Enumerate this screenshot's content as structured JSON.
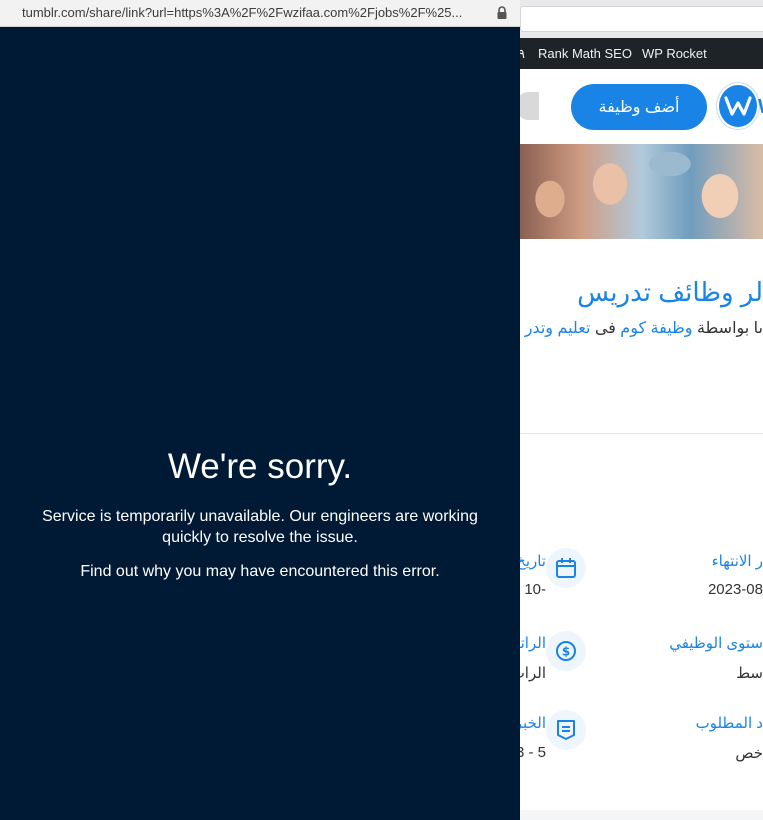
{
  "popup": {
    "url": "tumblr.com/share/link?url=https%3A%2F%2Fwzifaa.com%2Fjobs%2F%25...",
    "title": "We're sorry.",
    "message": "Service is temporarily unavailable. Our engineers are working quickly to resolve the issue.",
    "link_text": "Find out why you may have encountered this error.",
    "background_color": "#001935"
  },
  "admin_bar": {
    "items": [
      "Rank Math SEO",
      "WP Rocket"
    ]
  },
  "site_header": {
    "add_job_label": "أضف وظيفة",
    "logo_letter": "W",
    "accent_color": "#1a84e6"
  },
  "job": {
    "title": "لر وظائف تدريس",
    "byline_prefix": "ىا بواسطة",
    "byline_author": "وظيفة كوم",
    "byline_in": "فى",
    "byline_category": "تعليم وتدر"
  },
  "details": {
    "end_date_label": "ر الانتهاء",
    "end_date_value": "2023-08",
    "level_label": "ستوى الوظيفي",
    "level_value": "سط",
    "experience_label": "د المطلوب",
    "experience_value": "خص",
    "col2": {
      "date_label": "تاريخ",
      "date_value": "10-",
      "salary_label": "الراتب",
      "salary_value": "الرات",
      "experience_label": "الخبر",
      "experience_value": "3 - 5"
    }
  },
  "icons": [
    "lock-icon",
    "calendar-icon",
    "dollar-icon",
    "certificate-icon",
    "user-avatar-icon",
    "site-logo-icon"
  ]
}
